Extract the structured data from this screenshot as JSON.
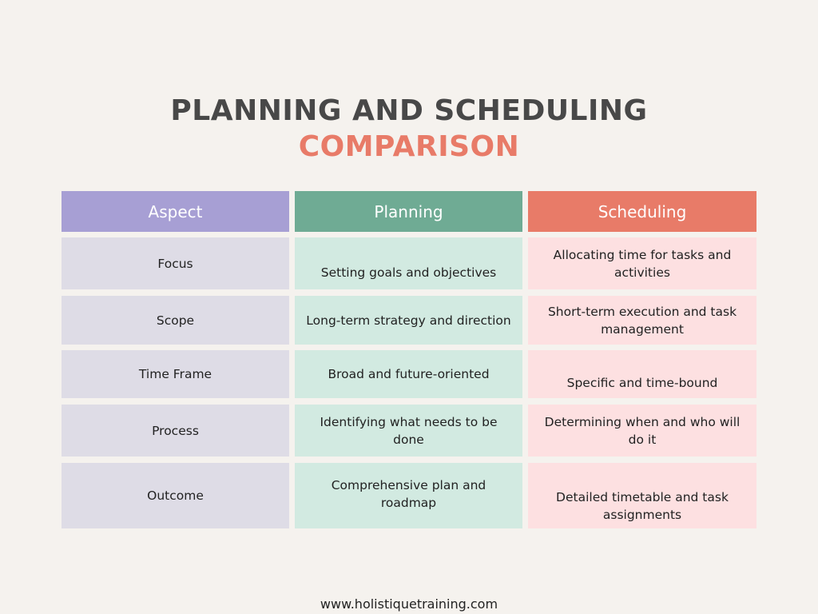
{
  "title": {
    "line1": "PLANNING AND SCHEDULING",
    "line2": "COMPARISON"
  },
  "colors": {
    "aspect_header": "#a79fd4",
    "planning_header": "#6fab94",
    "scheduling_header": "#e87b68",
    "title_accent": "#e87b68"
  },
  "table": {
    "headers": [
      "Aspect",
      "Planning",
      "Scheduling"
    ],
    "rows": [
      [
        "Focus",
        "Setting goals and objectives",
        "Allocating time for tasks and activities"
      ],
      [
        "Scope",
        "Long-term strategy and direction",
        "Short-term execution and task management"
      ],
      [
        "Time Frame",
        "Broad and future-oriented",
        "Specific and time-bound"
      ],
      [
        "Process",
        "Identifying what needs to be done",
        "Determining when and who will do it"
      ],
      [
        "Outcome",
        "Comprehensive plan and roadmap",
        "Detailed timetable and task assignments"
      ]
    ]
  },
  "footer": {
    "url": "www.holistiquetraining.com"
  }
}
